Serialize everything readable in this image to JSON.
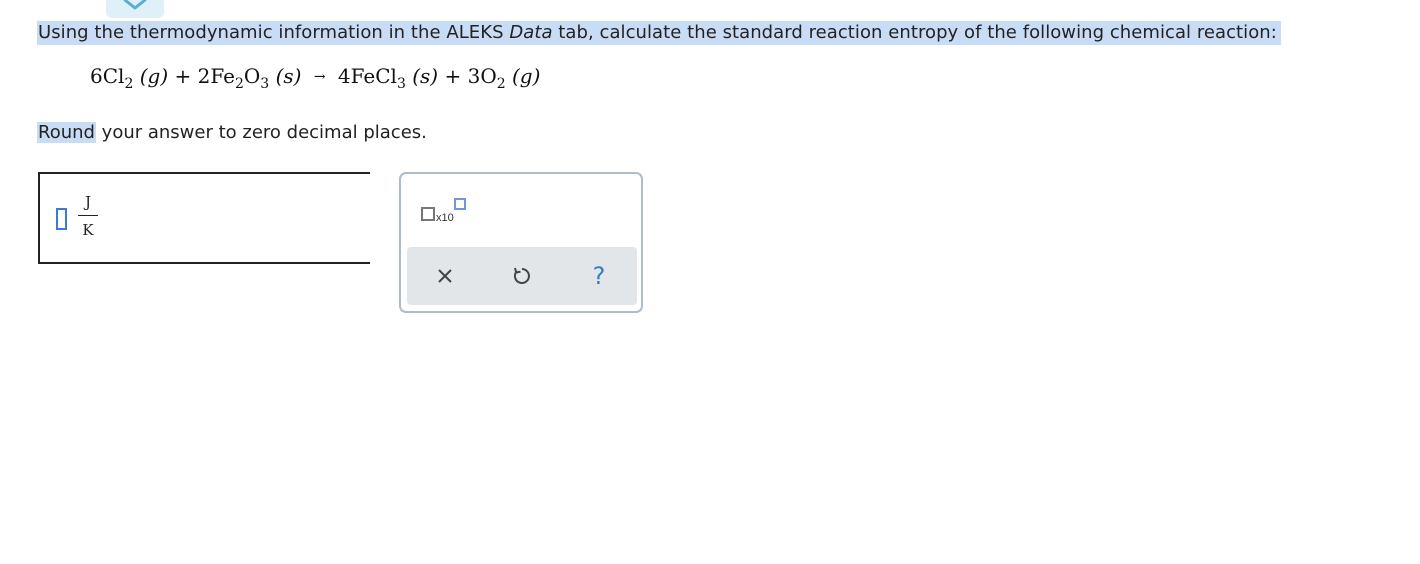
{
  "prompt": {
    "part1": "Using the thermodynamic information in the ALEKS ",
    "data_word": "Data",
    "part2": " tab, calculate the standard reaction entropy of the following chemical reaction:"
  },
  "equation": {
    "r1_coef": "6Cl",
    "r1_sub": "2",
    "r1_phase": "(g)",
    "plus1": "+",
    "r2_coef": "2Fe",
    "r2_sub1": "2",
    "r2_mid": "O",
    "r2_sub2": "3",
    "r2_phase": "(s)",
    "arrow": "→",
    "p1_coef": "4FeCl",
    "p1_sub": "3",
    "p1_phase": "(s)",
    "plus2": "+",
    "p2_coef": "3O",
    "p2_sub": "2",
    "p2_phase": "(g)"
  },
  "instruction": {
    "highlight": "Round",
    "rest": " your answer to zero decimal places."
  },
  "answer": {
    "value": "",
    "unit_numerator": "J",
    "unit_denominator": "K"
  },
  "tools": {
    "sci_notation_label": "x10",
    "icons": [
      "scientific-notation-icon",
      "clear-icon",
      "undo-icon",
      "help-icon"
    ],
    "help_glyph": "?"
  },
  "colors": {
    "highlight": "#c9dcf5",
    "accent": "#2f7fc7",
    "panel_border": "#aebdcd",
    "action_bar": "#e3e6e9"
  }
}
